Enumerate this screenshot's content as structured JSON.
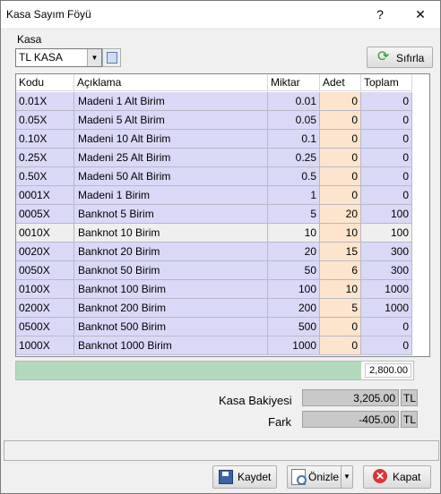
{
  "window": {
    "title": "Kasa Sayım Föyü",
    "help": "?",
    "close": "✕"
  },
  "kasa": {
    "label": "Kasa",
    "selected": "TL KASA"
  },
  "reset_label": "Sıfırla",
  "grid": {
    "headers": {
      "code": "Kodu",
      "desc": "Açıklama",
      "qty": "Miktar",
      "cnt": "Adet",
      "tot": "Toplam"
    },
    "rows": [
      {
        "code": "0.01X",
        "desc": "Madeni 1 Alt Birim",
        "qty": "0.01",
        "cnt": "0",
        "tot": "0"
      },
      {
        "code": "0.05X",
        "desc": "Madeni 5 Alt Birim",
        "qty": "0.05",
        "cnt": "0",
        "tot": "0"
      },
      {
        "code": "0.10X",
        "desc": "Madeni 10 Alt Birim",
        "qty": "0.1",
        "cnt": "0",
        "tot": "0"
      },
      {
        "code": "0.25X",
        "desc": "Madeni 25 Alt Birim",
        "qty": "0.25",
        "cnt": "0",
        "tot": "0"
      },
      {
        "code": "0.50X",
        "desc": "Madeni 50 Alt Birim",
        "qty": "0.5",
        "cnt": "0",
        "tot": "0"
      },
      {
        "code": "0001X",
        "desc": "Madeni 1 Birim",
        "qty": "1",
        "cnt": "0",
        "tot": "0"
      },
      {
        "code": "0005X",
        "desc": "Banknot 5 Birim",
        "qty": "5",
        "cnt": "20",
        "tot": "100"
      },
      {
        "code": "0010X",
        "desc": "Banknot 10 Birim",
        "qty": "10",
        "cnt": "10",
        "tot": "100"
      },
      {
        "code": "0020X",
        "desc": "Banknot 20 Birim",
        "qty": "20",
        "cnt": "15",
        "tot": "300"
      },
      {
        "code": "0050X",
        "desc": "Banknot 50 Birim",
        "qty": "50",
        "cnt": "6",
        "tot": "300"
      },
      {
        "code": "0100X",
        "desc": "Banknot 100 Birim",
        "qty": "100",
        "cnt": "10",
        "tot": "1000"
      },
      {
        "code": "0200X",
        "desc": "Banknot 200 Birim",
        "qty": "200",
        "cnt": "5",
        "tot": "1000"
      },
      {
        "code": "0500X",
        "desc": "Banknot 500 Birim",
        "qty": "500",
        "cnt": "0",
        "tot": "0"
      },
      {
        "code": "1000X",
        "desc": "Banknot 1000 Birim",
        "qty": "1000",
        "cnt": "0",
        "tot": "0"
      }
    ],
    "selected_row": 7
  },
  "total_progress": {
    "value": "2,800.00",
    "fill_fraction": 0.87
  },
  "summary": {
    "balance_label": "Kasa Bakiyesi",
    "balance_value": "3,205.00",
    "balance_cur": "TL",
    "diff_label": "Fark",
    "diff_value": "-405.00",
    "diff_cur": "TL"
  },
  "buttons": {
    "save": "Kaydet",
    "preview": "Önizle",
    "close": "Kapat"
  }
}
